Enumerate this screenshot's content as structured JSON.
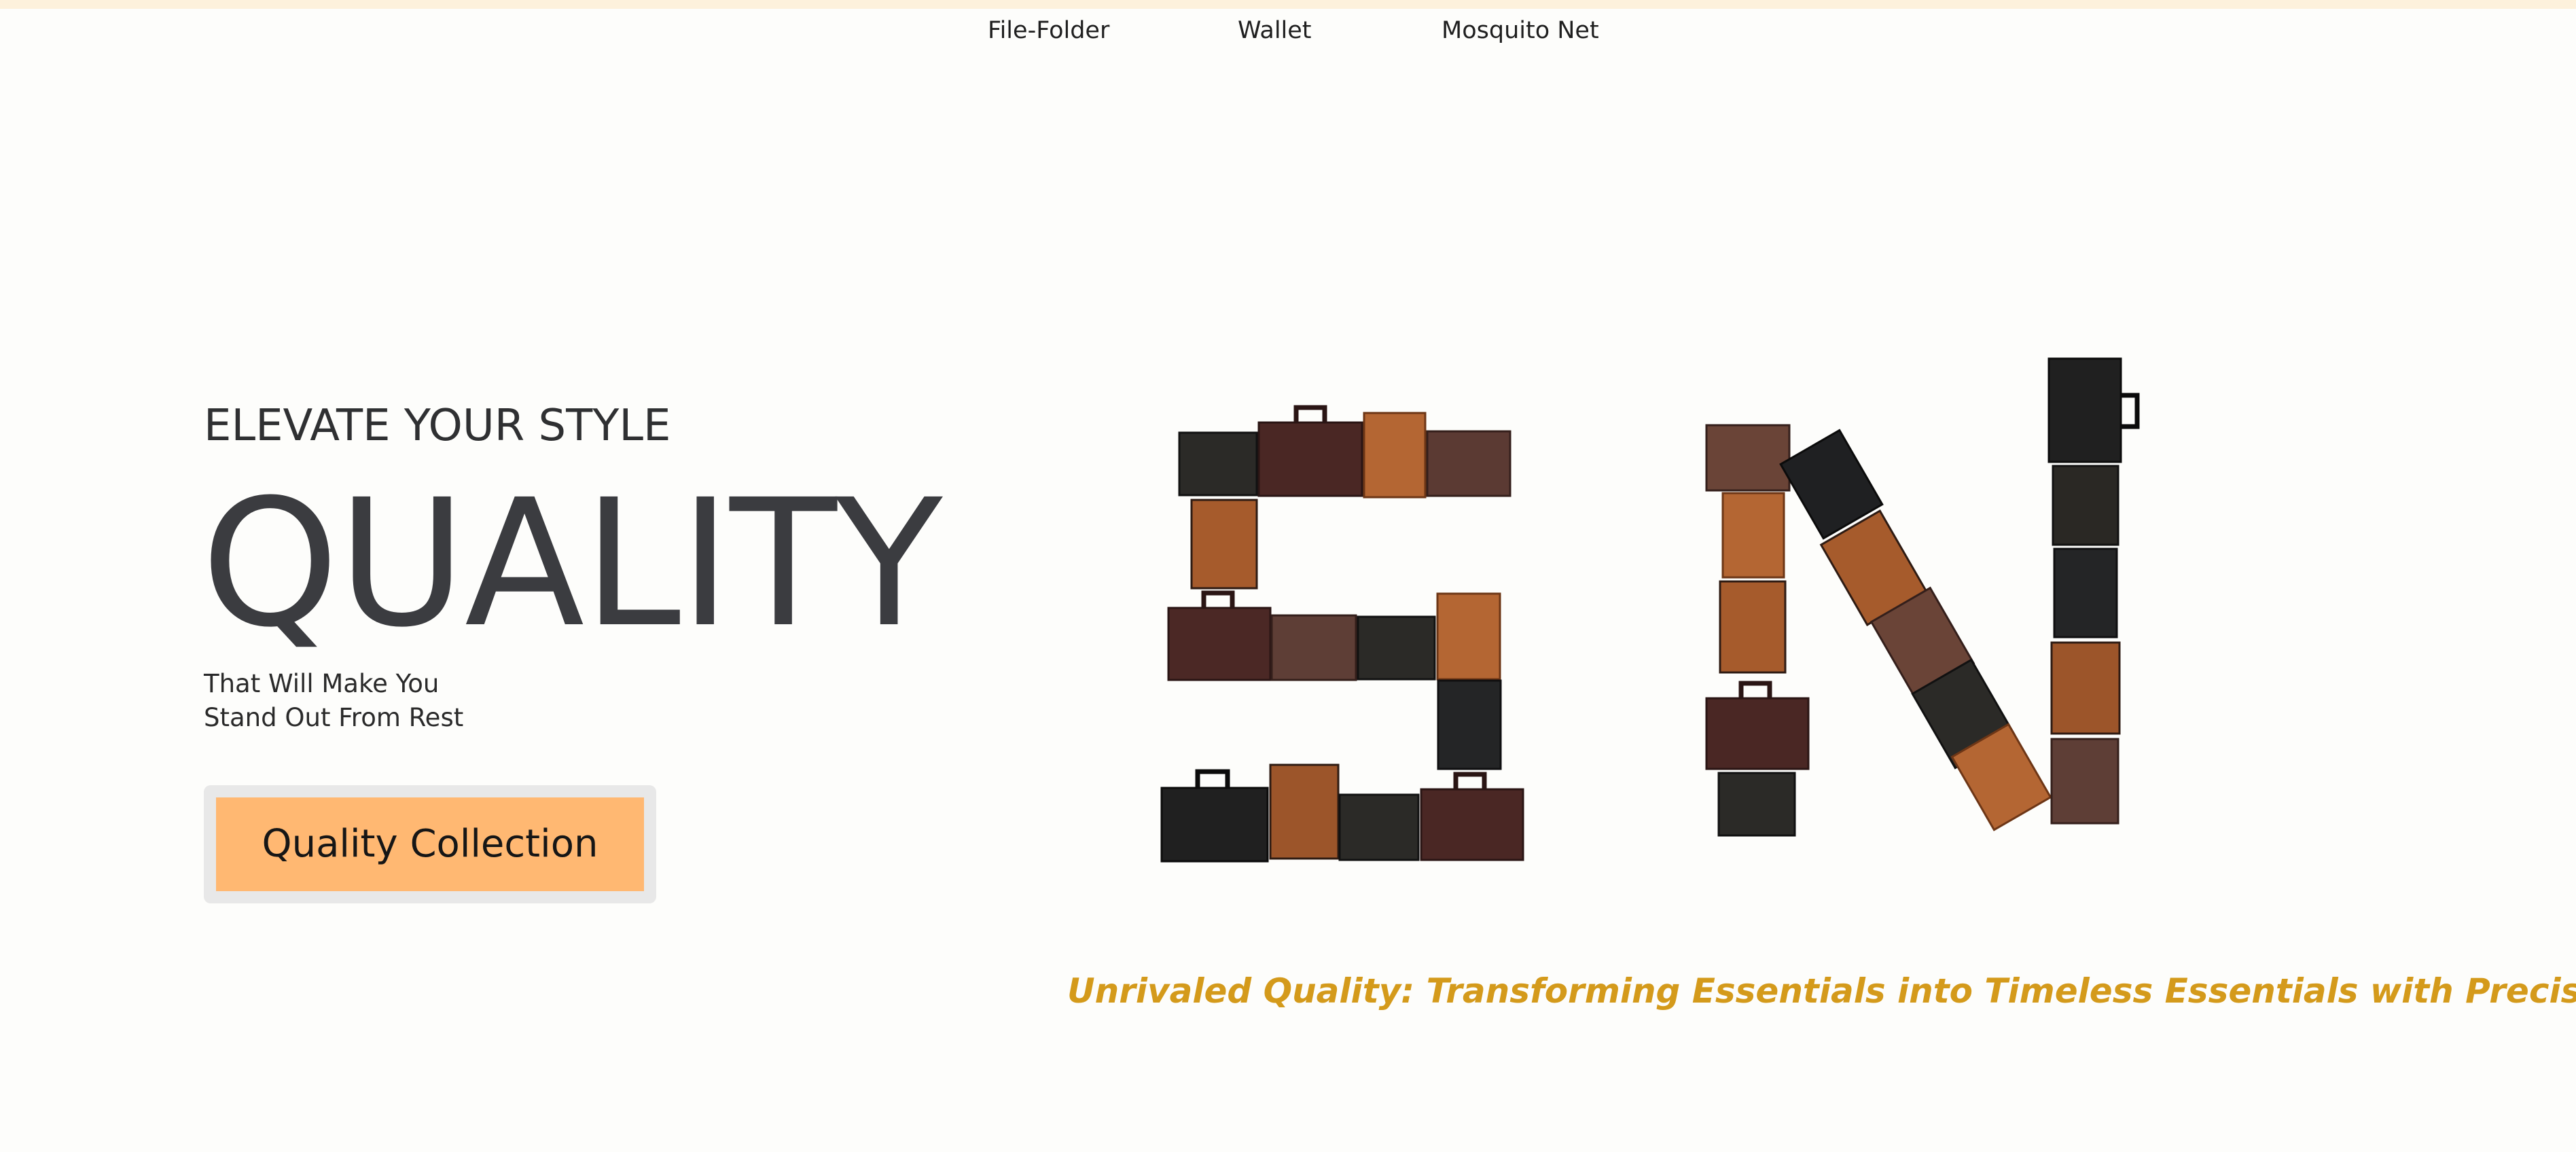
{
  "nav": {
    "links": [
      "File-Folder",
      "Wallet",
      "Mosquito Net"
    ]
  },
  "hero": {
    "eyebrow": "ELEVATE YOUR STYLE",
    "headline": "QUALITY",
    "sub_line1": "That Will Make You",
    "sub_line2": "Stand Out From Rest",
    "cta_label": "Quality Collection"
  },
  "tagline": "Unrivaled Quality: Transforming Essentials into Timeless Essentials with Precision.",
  "colors": {
    "accent_button": "#ffb872",
    "tagline": "#d49a1b",
    "top_strip": "#fdf1dc"
  },
  "art": {
    "description_icon": "sn-monogram-of-leather-goods"
  }
}
